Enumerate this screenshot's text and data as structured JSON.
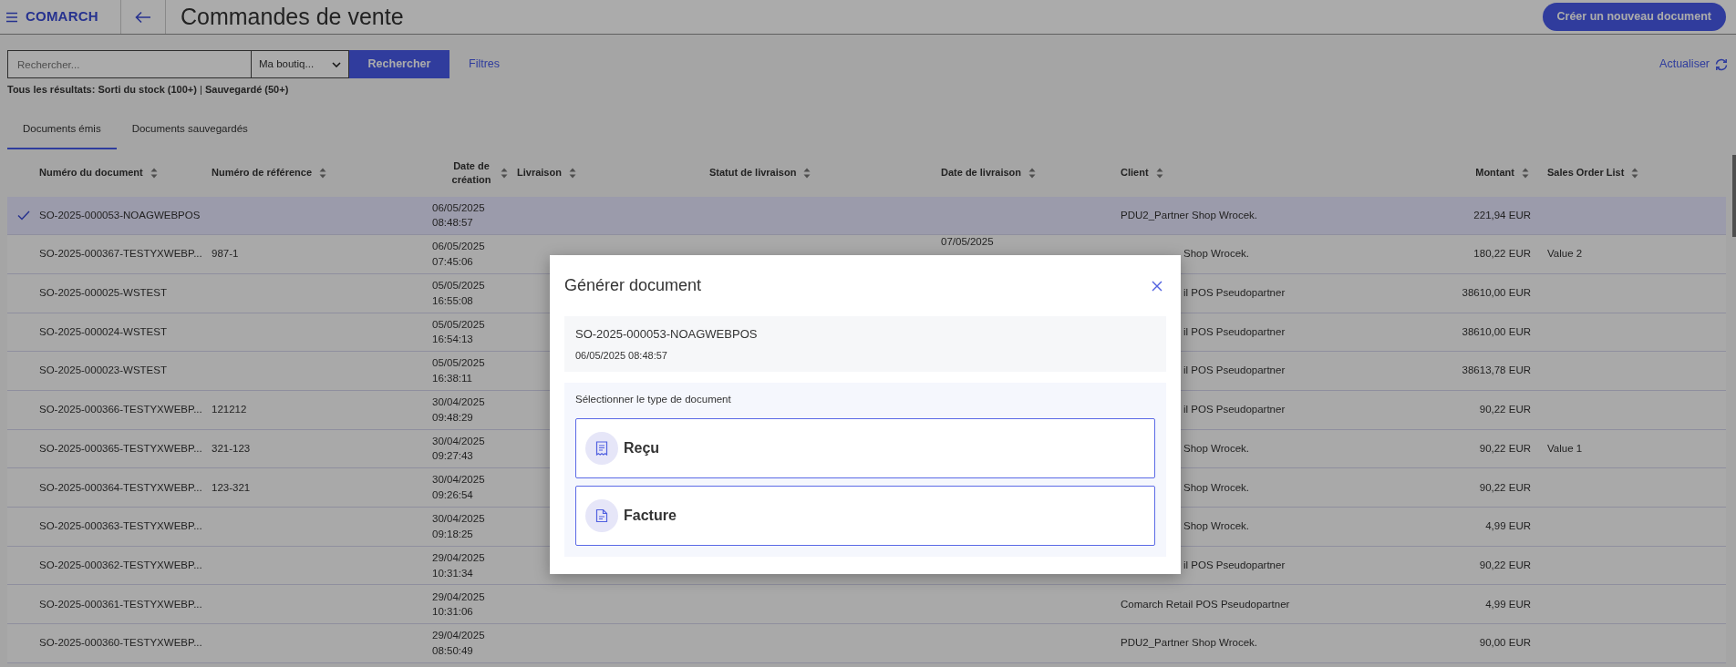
{
  "header": {
    "app_name": "COMARCH",
    "title": "Commandes de vente",
    "create_button": "Créer un nouveau document"
  },
  "search": {
    "placeholder": "Rechercher...",
    "store_select": "Ma boutiq...",
    "search_button": "Rechercher",
    "filters_link": "Filtres",
    "refresh_link": "Actualiser"
  },
  "results_summary": "**Tous les résultats: Sorti du stock (100+)** | **Sauvegardé (50+)**",
  "tabs": [
    {
      "label": "Documents émis",
      "selected": true
    },
    {
      "label": "Documents sauvegardés",
      "selected": false
    }
  ],
  "table": {
    "columns": [
      "Numéro du document",
      "Numéro de référence",
      "Date de création",
      "Livraison",
      "Statut de livraison",
      "Date de livraison",
      "Client",
      "Montant",
      "Sales Order List"
    ],
    "rows": [
      {
        "selected": true,
        "document_number": "SO-2025-000053-NOAGWEBPOS",
        "created_date": "06/05/2025",
        "created_time": "08:48:57",
        "client": "PDU2_Partner Shop Wrocek.",
        "client_covered": false,
        "amount": "221,94 EUR"
      },
      {
        "selected": false,
        "document_number": "SO-2025-000367-TESTYXWEBP...",
        "reference": "987-1",
        "created_date": "06/05/2025",
        "created_time": "07:45:06",
        "delivery_date": "07/05/2025",
        "client": "Shop Wrocek.",
        "client_covered": true,
        "amount": "180,22 EUR",
        "sales_order_list": "Value 2"
      },
      {
        "selected": false,
        "document_number": "SO-2025-000025-WSTEST",
        "created_date": "05/05/2025",
        "created_time": "16:55:08",
        "client": "il POS Pseudopartner",
        "client_covered": true,
        "amount": "38610,00 EUR"
      },
      {
        "selected": false,
        "document_number": "SO-2025-000024-WSTEST",
        "created_date": "05/05/2025",
        "created_time": "16:54:13",
        "client": "il POS Pseudopartner",
        "client_covered": true,
        "amount": "38610,00 EUR"
      },
      {
        "selected": false,
        "document_number": "SO-2025-000023-WSTEST",
        "created_date": "05/05/2025",
        "created_time": "16:38:11",
        "client": "il POS Pseudopartner",
        "client_covered": true,
        "amount": "38613,78 EUR"
      },
      {
        "selected": false,
        "document_number": "SO-2025-000366-TESTYXWEBP...",
        "reference": "121212",
        "created_date": "30/04/2025",
        "created_time": "09:48:29",
        "client": "il POS Pseudopartner",
        "client_covered": true,
        "amount": "90,22 EUR"
      },
      {
        "selected": false,
        "document_number": "SO-2025-000365-TESTYXWEBP...",
        "reference": "321-123",
        "created_date": "30/04/2025",
        "created_time": "09:27:43",
        "client": "Shop Wrocek.",
        "client_covered": true,
        "amount": "90,22 EUR",
        "sales_order_list": "Value 1"
      },
      {
        "selected": false,
        "document_number": "SO-2025-000364-TESTYXWEBP...",
        "reference": "123-321",
        "created_date": "30/04/2025",
        "created_time": "09:26:54",
        "client": "Shop Wrocek.",
        "client_covered": true,
        "amount": "90,22 EUR"
      },
      {
        "selected": false,
        "document_number": "SO-2025-000363-TESTYXWEBP...",
        "created_date": "30/04/2025",
        "created_time": "09:18:25",
        "client": "Shop Wrocek.",
        "client_covered": true,
        "amount": "4,99 EUR"
      },
      {
        "selected": false,
        "document_number": "SO-2025-000362-TESTYXWEBP...",
        "created_date": "29/04/2025",
        "created_time": "10:31:34",
        "client": "il POS Pseudopartner",
        "client_covered": true,
        "amount": "90,22 EUR"
      },
      {
        "selected": false,
        "document_number": "SO-2025-000361-TESTYXWEBP...",
        "created_date": "29/04/2025",
        "created_time": "10:31:06",
        "client": "Comarch Retail POS Pseudopartner",
        "client_covered": false,
        "amount": "4,99 EUR"
      },
      {
        "selected": false,
        "document_number": "SO-2025-000360-TESTYXWEBP...",
        "created_date": "29/04/2025",
        "created_time": "08:50:49",
        "client": "PDU2_Partner Shop Wrocek.",
        "client_covered": false,
        "amount": "90,00 EUR"
      }
    ]
  },
  "modal": {
    "title": "Générer document",
    "document_number": "SO-2025-000053-NOAGWEBPOS",
    "document_date": "06/05/2025 08:48:57",
    "prompt": "Sélectionner le type de document",
    "options": [
      {
        "label": "Reçu",
        "kind": "receipt"
      },
      {
        "label": "Facture",
        "kind": "invoice"
      }
    ]
  }
}
